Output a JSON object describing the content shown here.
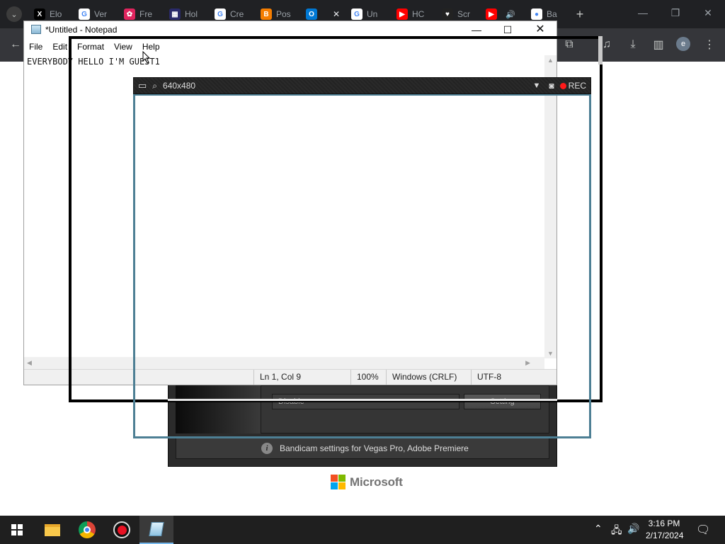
{
  "colors": {
    "chrome_tabstrip": "#202124",
    "chrome_toolbar": "#35363a",
    "bandicam_frame": "#4d7f94",
    "rec_red": "#ff1a1a",
    "taskbar": "#1f1f1f",
    "ms_red": "#f25022",
    "ms_green": "#7fba00",
    "ms_blue": "#00a4ef",
    "ms_yellow": "#ffb900"
  },
  "chrome": {
    "tabs": [
      {
        "label": "Elo",
        "icon": "x-logo-icon",
        "glyph": "X",
        "color": "#000000"
      },
      {
        "label": "Ver",
        "icon": "google-icon",
        "glyph": "G",
        "color": "#ffffff"
      },
      {
        "label": "Fre",
        "icon": "flower-icon",
        "glyph": "✿",
        "color": "#e0245e"
      },
      {
        "label": "Hol",
        "icon": "grid-app-icon",
        "glyph": "▦",
        "color": "#2a2a6a"
      },
      {
        "label": "Cre",
        "icon": "google-icon",
        "glyph": "G",
        "color": "#ffffff"
      },
      {
        "label": "Pos",
        "icon": "blogger-icon",
        "glyph": "B",
        "color": "#f57d00"
      },
      {
        "label": "",
        "icon": "outlook-icon",
        "glyph": "O",
        "color": "#0078d4"
      },
      {
        "label": "Un",
        "icon": "google-icon",
        "glyph": "G",
        "color": "#ffffff"
      },
      {
        "label": "HC",
        "icon": "youtube-icon",
        "glyph": "▶",
        "color": "#ff0000"
      },
      {
        "label": "Scr",
        "icon": "record-heart-icon",
        "glyph": "♥",
        "color": "#222222"
      },
      {
        "label": "",
        "icon": "youtube-icon",
        "glyph": "▶",
        "color": "#ff0000"
      },
      {
        "label": "Ba",
        "icon": "bandicam-icon",
        "glyph": "●",
        "color": "#ffffff"
      }
    ],
    "new_tab_glyph": "+",
    "avatar_letter": "e"
  },
  "notepad": {
    "title": "*Untitled - Notepad",
    "menu": [
      "File",
      "Edit",
      "Format",
      "View",
      "Help"
    ],
    "content": "EVERYBODY HELLO I'M GUEST1",
    "status": {
      "position": "Ln 1, Col 9",
      "zoom": "100%",
      "line_ending": "Windows (CRLF)",
      "encoding": "UTF-8"
    }
  },
  "bandicam": {
    "resolution": "640x480",
    "rec_label": "REC",
    "disable_label": "Disable",
    "setting_label": "Setting",
    "info_text": "Bandicam settings for Vegas Pro, Adobe Premiere"
  },
  "microsoft": {
    "logo_text": "Microsoft"
  },
  "taskbar": {
    "time": "3:16 PM",
    "date": "2/17/2024"
  }
}
